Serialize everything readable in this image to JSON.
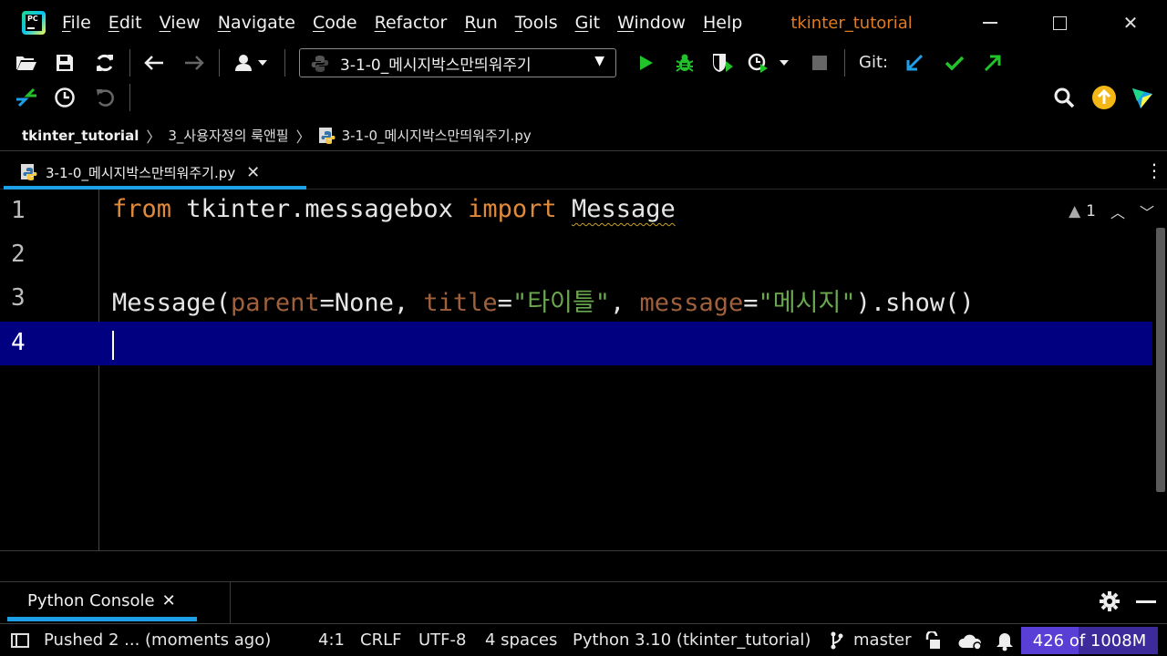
{
  "app": {
    "logo_text": "PC",
    "project_title": "tkinter_tutorial"
  },
  "menu": [
    {
      "mnemonic": "F",
      "rest": "ile"
    },
    {
      "mnemonic": "E",
      "rest": "dit"
    },
    {
      "mnemonic": "V",
      "rest": "iew"
    },
    {
      "mnemonic": "N",
      "rest": "avigate"
    },
    {
      "mnemonic": "C",
      "rest": "ode"
    },
    {
      "mnemonic": "R",
      "rest": "efactor"
    },
    {
      "mnemonic": "R",
      "rest": "un",
      "mn_style": "u"
    },
    {
      "mnemonic": "T",
      "rest": "ools"
    },
    {
      "mnemonic": "G",
      "rest": "it"
    },
    {
      "mnemonic": "W",
      "rest": "indow"
    },
    {
      "mnemonic": "H",
      "rest": "elp"
    }
  ],
  "toolbar": {
    "run_config": "3-1-0_메시지박스만띄워주기",
    "git_label": "Git:"
  },
  "breadcrumbs": {
    "project": "tkinter_tutorial",
    "folder": "3_사용자정의 룩앤필",
    "file": "3-1-0_메시지박스만띄워주기.py"
  },
  "editor_tab": {
    "label": "3-1-0_메시지박스만띄워주기.py",
    "close": "✕"
  },
  "editor": {
    "line_numbers": [
      "1",
      "2",
      "3",
      "4"
    ],
    "line1": {
      "kw1": "from",
      "mod": " tkinter.messagebox ",
      "kw2": "import",
      "name": "Message"
    },
    "line3": {
      "call": "Message(",
      "p1": "parent",
      "eq1": "=None, ",
      "p2": "title",
      "eq2": "=",
      "s1": "\"타이틀\"",
      "comma": ", ",
      "p3": "message",
      "eq3": "=",
      "s2": "\"메시지\"",
      "tail": ").show()"
    },
    "inspection_count": "1",
    "cursor_line": 4
  },
  "tool_window": {
    "console_tab": "Python Console",
    "close": "✕"
  },
  "statusbar": {
    "vcs_message": "Pushed 2 ... (moments ago)",
    "position": "4:1",
    "line_sep": "CRLF",
    "encoding": "UTF-8",
    "indent": "4 spaces",
    "interpreter": "Python 3.10 (tkinter_tutorial)",
    "branch": "master",
    "memory": "426 of 1008M",
    "memory_used_fraction": 0.42
  },
  "colors": {
    "accent": "#1da0e8",
    "current_line": "#000080",
    "keyword": "#e08a3a",
    "string": "#6aa84f",
    "run_green": "#22c22a",
    "git_update": "#1da0e8",
    "project_title": "#e07b22"
  },
  "icons": [
    "open-folder-icon",
    "save-icon",
    "sync-icon",
    "back-arrow-icon",
    "forward-arrow-icon",
    "user-icon",
    "run-icon",
    "debug-icon",
    "coverage-icon",
    "profile-icon",
    "stop-icon",
    "git-update-icon",
    "git-commit-icon",
    "git-push-icon",
    "git-compare-icon",
    "history-icon",
    "rollback-icon",
    "search-icon",
    "ide-update-icon",
    "plugin-logo-icon",
    "settings-gear-icon"
  ]
}
